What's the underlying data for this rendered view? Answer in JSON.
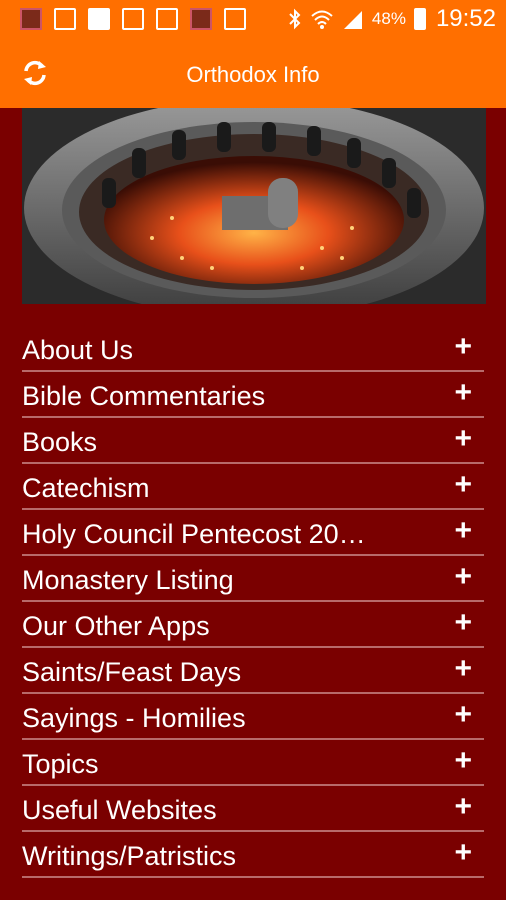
{
  "status_bar": {
    "icons": [
      "itrsc-app-icon",
      "facebook-icon",
      "no-signal-icon",
      "office-icon",
      "image-icon",
      "photo-icon",
      "mail-icon"
    ],
    "bluetooth_icon": "bluetooth-icon",
    "wifi_icon": "wifi-icon",
    "signal_icon": "cell-signal-icon",
    "battery_percent": "48%",
    "time": "19:52"
  },
  "app_bar": {
    "title": "Orthodox Info",
    "refresh_icon": "refresh-icon"
  },
  "colors": {
    "app_bar": "#ff6f00",
    "background": "#7a0000",
    "divider": "#b86a6a",
    "text": "#ffffff"
  },
  "menu": {
    "items": [
      {
        "label": "About Us",
        "expand": "+"
      },
      {
        "label": "Bible Commentaries",
        "expand": "+"
      },
      {
        "label": "Books",
        "expand": "+"
      },
      {
        "label": "Catechism",
        "expand": "+"
      },
      {
        "label": "Holy Council Pentecost 20…",
        "expand": "+"
      },
      {
        "label": "Monastery Listing",
        "expand": "+"
      },
      {
        "label": "Our Other Apps",
        "expand": "+"
      },
      {
        "label": "Saints/Feast Days",
        "expand": "+"
      },
      {
        "label": "Sayings - Homilies",
        "expand": "+"
      },
      {
        "label": "Topics",
        "expand": "+"
      },
      {
        "label": "Useful Websites",
        "expand": "+"
      },
      {
        "label": "Writings/Patristics",
        "expand": "+"
      }
    ]
  }
}
